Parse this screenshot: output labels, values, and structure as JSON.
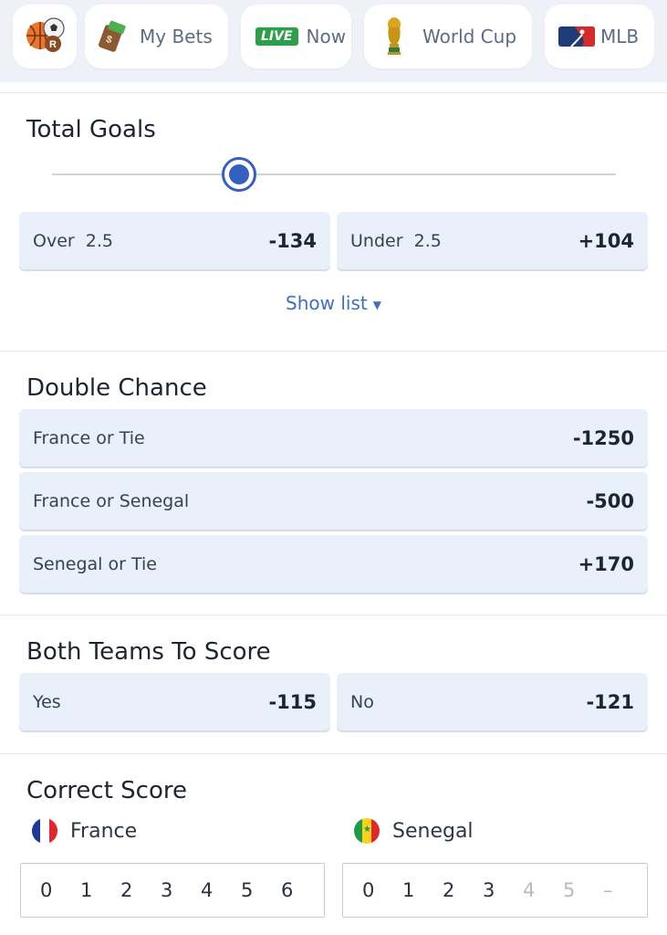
{
  "nav": {
    "items": [
      {
        "icon": "sports-ball-icon",
        "label": ""
      },
      {
        "icon": "money-bag-icon",
        "label": "My Bets"
      },
      {
        "icon": "live-badge-icon",
        "badge": "LIVE",
        "label": "Now"
      },
      {
        "icon": "trophy-icon",
        "label": "World Cup"
      },
      {
        "icon": "mlb-logo-icon",
        "label": "MLB"
      }
    ]
  },
  "total_goals": {
    "title": "Total Goals",
    "slider_value": 2.5,
    "over": {
      "label": "Over",
      "line": "2.5",
      "price": "-134"
    },
    "under": {
      "label": "Under",
      "line": "2.5",
      "price": "+104"
    },
    "show_list": "Show list"
  },
  "double_chance": {
    "title": "Double Chance",
    "options": [
      {
        "label": "France or Tie",
        "price": "-1250"
      },
      {
        "label": "France or Senegal",
        "price": "-500"
      },
      {
        "label": "Senegal or Tie",
        "price": "+170"
      }
    ]
  },
  "btts": {
    "title": "Both Teams To Score",
    "yes": {
      "label": "Yes",
      "price": "-115"
    },
    "no": {
      "label": "No",
      "price": "-121"
    }
  },
  "correct_score": {
    "title": "Correct Score",
    "home": {
      "name": "France",
      "scores": [
        "0",
        "1",
        "2",
        "3",
        "4",
        "5",
        "6"
      ]
    },
    "away": {
      "name": "Senegal",
      "scores": [
        "0",
        "1",
        "2",
        "3",
        "4",
        "5",
        "–"
      ]
    }
  },
  "colors": {
    "accent": "#3560c2",
    "button_bg": "#eaf0f9",
    "link": "#3f6fbf"
  }
}
